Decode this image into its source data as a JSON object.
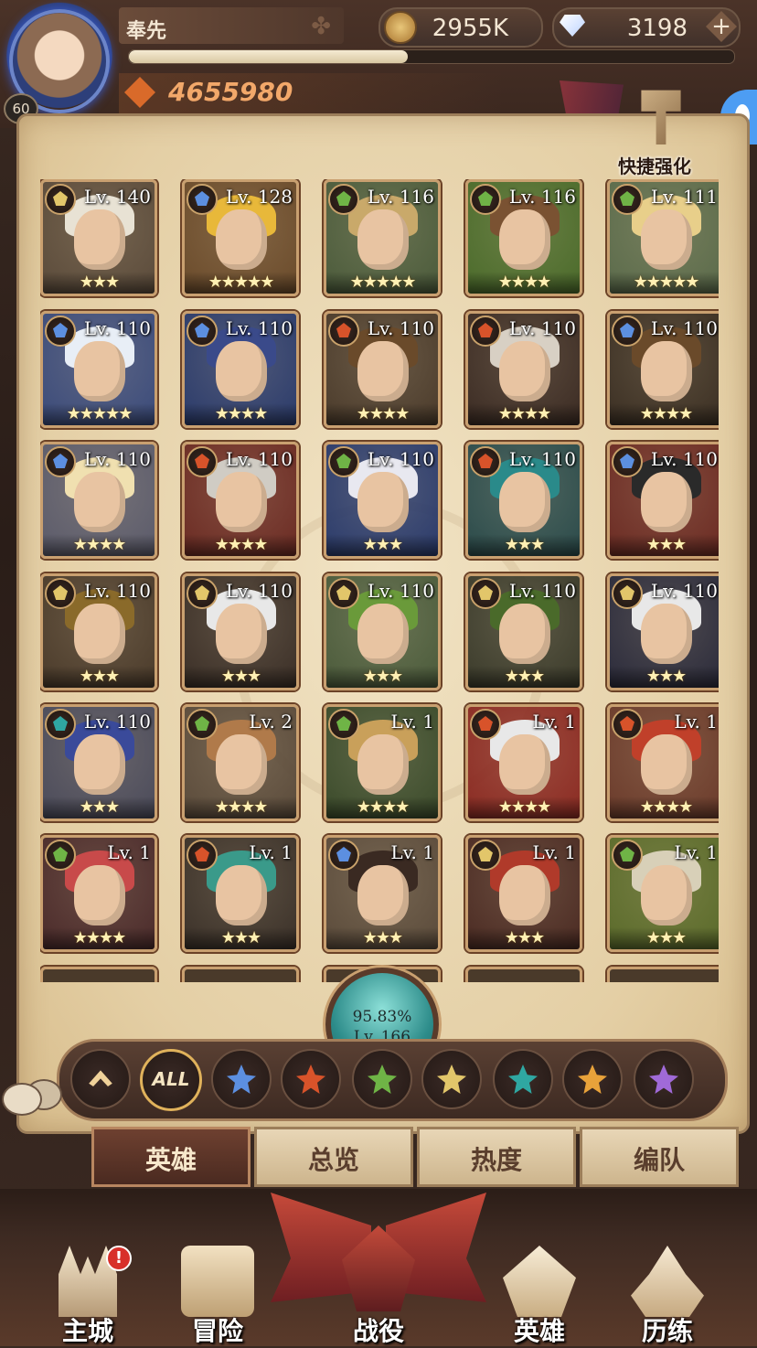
{
  "player": {
    "name": "奉先",
    "level": "60",
    "xp_fraction": 0.46,
    "power": "4655980"
  },
  "currency": {
    "gold": "2955K",
    "diamonds": "3198",
    "add_label": "+"
  },
  "quick_enhance_label": "快捷强化",
  "factions": {
    "lightbearer": "#e8a23a",
    "mauler": "#d8532a",
    "wilder": "#6fb446",
    "graveborn": "#2fa7a2",
    "celestial": "#e2c66a",
    "hypogean": "#a06ad8",
    "blue": "#5c8fe0"
  },
  "heroes": [
    {
      "level": "Lv. 140",
      "stars": "★★★",
      "faction": "celestial",
      "hair": "#e8e2d4",
      "bg": "#5a4a3a"
    },
    {
      "level": "Lv. 128",
      "stars": "★★★★★",
      "faction": "blue",
      "hair": "#e8b83a",
      "bg": "#6a4a2a"
    },
    {
      "level": "Lv. 116",
      "stars": "★★★★★",
      "faction": "wilder",
      "hair": "#c9a96a",
      "bg": "#4a5a3a"
    },
    {
      "level": "Lv. 116",
      "stars": "★★★★",
      "faction": "wilder",
      "hair": "#7a5232",
      "bg": "#4a6a2a"
    },
    {
      "level": "Lv. 111",
      "stars": "★★★★★",
      "faction": "wilder",
      "hair": "#e8cf8a",
      "bg": "#5a6a4a"
    },
    {
      "level": "Lv. 110",
      "stars": "★★★★★",
      "faction": "blue",
      "hair": "#e8eef6",
      "bg": "#3a4a7a"
    },
    {
      "level": "Lv. 110",
      "stars": "★★★★",
      "faction": "blue",
      "hair": "#3a4a8a",
      "bg": "#2a3a6a"
    },
    {
      "level": "Lv. 110",
      "stars": "★★★★",
      "faction": "mauler",
      "hair": "#6a4a2a",
      "bg": "#4a3a2a"
    },
    {
      "level": "Lv. 110",
      "stars": "★★★★",
      "faction": "mauler",
      "hair": "#d8d0c4",
      "bg": "#3a2a22"
    },
    {
      "level": "Lv. 110",
      "stars": "★★★★",
      "faction": "blue",
      "hair": "#6a4a2a",
      "bg": "#3a2e22"
    },
    {
      "level": "Lv. 110",
      "stars": "★★★★",
      "faction": "blue",
      "hair": "#f0e0b0",
      "bg": "#5a5a6a"
    },
    {
      "level": "Lv. 110",
      "stars": "★★★★",
      "faction": "mauler",
      "hair": "#d0ccc4",
      "bg": "#6a2a22"
    },
    {
      "level": "Lv. 110",
      "stars": "★★★",
      "faction": "wilder",
      "hair": "#e8e8f0",
      "bg": "#2a3a6a"
    },
    {
      "level": "Lv. 110",
      "stars": "★★★",
      "faction": "mauler",
      "hair": "#2a8a8a",
      "bg": "#2a4a4a"
    },
    {
      "level": "Lv. 110",
      "stars": "★★★",
      "faction": "blue",
      "hair": "#2a2a2a",
      "bg": "#6a2a22"
    },
    {
      "level": "Lv. 110",
      "stars": "★★★",
      "faction": "celestial",
      "hair": "#8a6a2a",
      "bg": "#4a3a2a"
    },
    {
      "level": "Lv. 110",
      "stars": "★★★",
      "faction": "celestial",
      "hair": "#e8e8e8",
      "bg": "#3a2e26"
    },
    {
      "level": "Lv. 110",
      "stars": "★★★",
      "faction": "celestial",
      "hair": "#6a9a3a",
      "bg": "#4a5a3a"
    },
    {
      "level": "Lv. 110",
      "stars": "★★★",
      "faction": "celestial",
      "hair": "#4a6a2a",
      "bg": "#3a3a2a"
    },
    {
      "level": "Lv. 110",
      "stars": "★★★",
      "faction": "celestial",
      "hair": "#e8e8e8",
      "bg": "#2a2a3a"
    },
    {
      "level": "Lv. 110",
      "stars": "★★★",
      "faction": "graveborn",
      "hair": "#3a4a9a",
      "bg": "#4a4a5a"
    },
    {
      "level": "Lv. 2",
      "stars": "★★★★",
      "faction": "wilder",
      "hair": "#b07a4a",
      "bg": "#5a4a3a"
    },
    {
      "level": "Lv. 1",
      "stars": "★★★★",
      "faction": "wilder",
      "hair": "#c9a05a",
      "bg": "#3a4a2a"
    },
    {
      "level": "Lv. 1",
      "stars": "★★★★",
      "faction": "mauler",
      "hair": "#e8e8e8",
      "bg": "#8a2a22"
    },
    {
      "level": "Lv. 1",
      "stars": "★★★★",
      "faction": "mauler",
      "hair": "#c0402a",
      "bg": "#6a3a2a"
    },
    {
      "level": "Lv. 1",
      "stars": "★★★★",
      "faction": "wilder",
      "hair": "#c84a4a",
      "bg": "#4a2a2a"
    },
    {
      "level": "Lv. 1",
      "stars": "★★★",
      "faction": "mauler",
      "hair": "#3a9a8a",
      "bg": "#3a3028"
    },
    {
      "level": "Lv. 1",
      "stars": "★★★",
      "faction": "blue",
      "hair": "#3a2a22",
      "bg": "#5a4a3a"
    },
    {
      "level": "Lv. 1",
      "stars": "★★★",
      "faction": "celestial",
      "hair": "#b03a2a",
      "bg": "#4a2a22"
    },
    {
      "level": "Lv. 1",
      "stars": "★★★",
      "faction": "wilder",
      "hair": "#d8d0b8",
      "bg": "#5a6a2a"
    }
  ],
  "progress": {
    "percent": "95.83%",
    "level": "Lv. 166"
  },
  "filters": {
    "all_label": "ALL",
    "buttons": [
      "up",
      "all",
      "blue",
      "mauler",
      "wilder",
      "celestial",
      "graveborn",
      "lightbearer",
      "hypogean"
    ]
  },
  "tabs": {
    "heroes": "英雄",
    "overview": "总览",
    "popularity": "热度",
    "formation": "编队"
  },
  "nav": {
    "city": "主城",
    "adventure": "冒险",
    "campaign": "战役",
    "heroes": "英雄",
    "trials": "历练",
    "alert": "!"
  }
}
